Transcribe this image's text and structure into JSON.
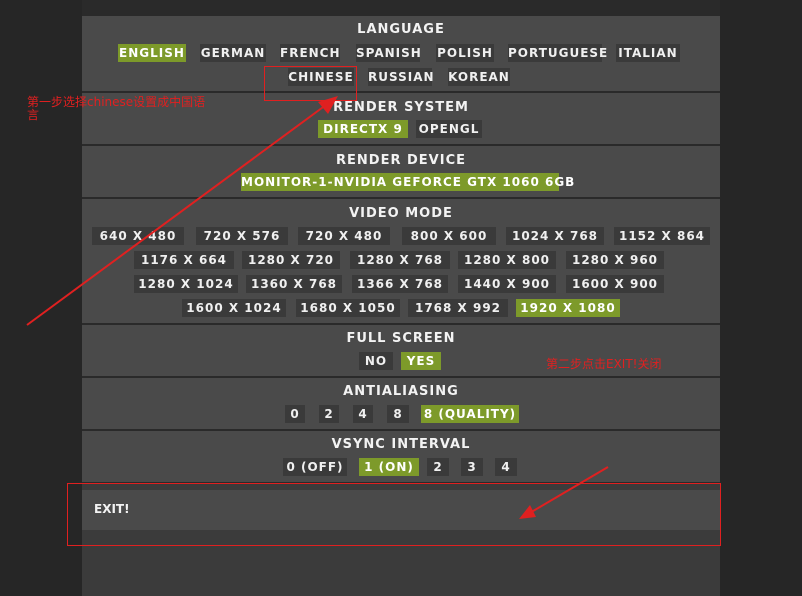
{
  "sections": {
    "language": {
      "title": "LANGUAGE",
      "options": [
        "ENGLISH",
        "GERMAN",
        "FRENCH",
        "SPANISH",
        "POLISH",
        "PORTUGUESE",
        "ITALIAN",
        "CHINESE",
        "RUSSIAN",
        "KOREAN"
      ],
      "selected": "ENGLISH"
    },
    "render_system": {
      "title": "RENDER SYSTEM",
      "options": [
        "DIRECTX 9",
        "OPENGL"
      ],
      "selected": "DIRECTX 9"
    },
    "render_device": {
      "title": "RENDER DEVICE",
      "options": [
        "MONITOR-1-NVIDIA GEFORCE GTX 1060 6GB"
      ],
      "selected": "MONITOR-1-NVIDIA GEFORCE GTX 1060 6GB"
    },
    "video_mode": {
      "title": "VIDEO MODE",
      "options": [
        "640 X 480",
        "720 X 576",
        "720 X 480",
        "800 X 600",
        "1024 X 768",
        "1152 X 864",
        "1176 X 664",
        "1280 X 720",
        "1280 X 768",
        "1280 X 800",
        "1280 X 960",
        "1280 X 1024",
        "1360 X 768",
        "1366 X 768",
        "1440 X 900",
        "1600 X 900",
        "1600 X 1024",
        "1680 X 1050",
        "1768 X 992",
        "1920 X 1080"
      ],
      "selected": "1920 X 1080"
    },
    "full_screen": {
      "title": "FULL SCREEN",
      "options": [
        "NO",
        "YES"
      ],
      "selected": "YES"
    },
    "antialiasing": {
      "title": "ANTIALIASING",
      "options": [
        "0",
        "2",
        "4",
        "8",
        "8 (QUALITY)"
      ],
      "selected": "8 (QUALITY)"
    },
    "vsync_interval": {
      "title": "VSYNC INTERVAL",
      "options": [
        "0 (OFF)",
        "1 (ON)",
        "2",
        "3",
        "4"
      ],
      "selected": "1 (ON)"
    }
  },
  "exit": {
    "label": "EXIT!"
  },
  "annotations": {
    "step1": "第一步选择chinese设置成中国语言",
    "step2": "第二步点击EXIT!关闭"
  },
  "colors": {
    "selected": "#7d9a2a",
    "button": "#3a3a3a",
    "section": "#4a4a4a",
    "annotation": "#e02020"
  }
}
